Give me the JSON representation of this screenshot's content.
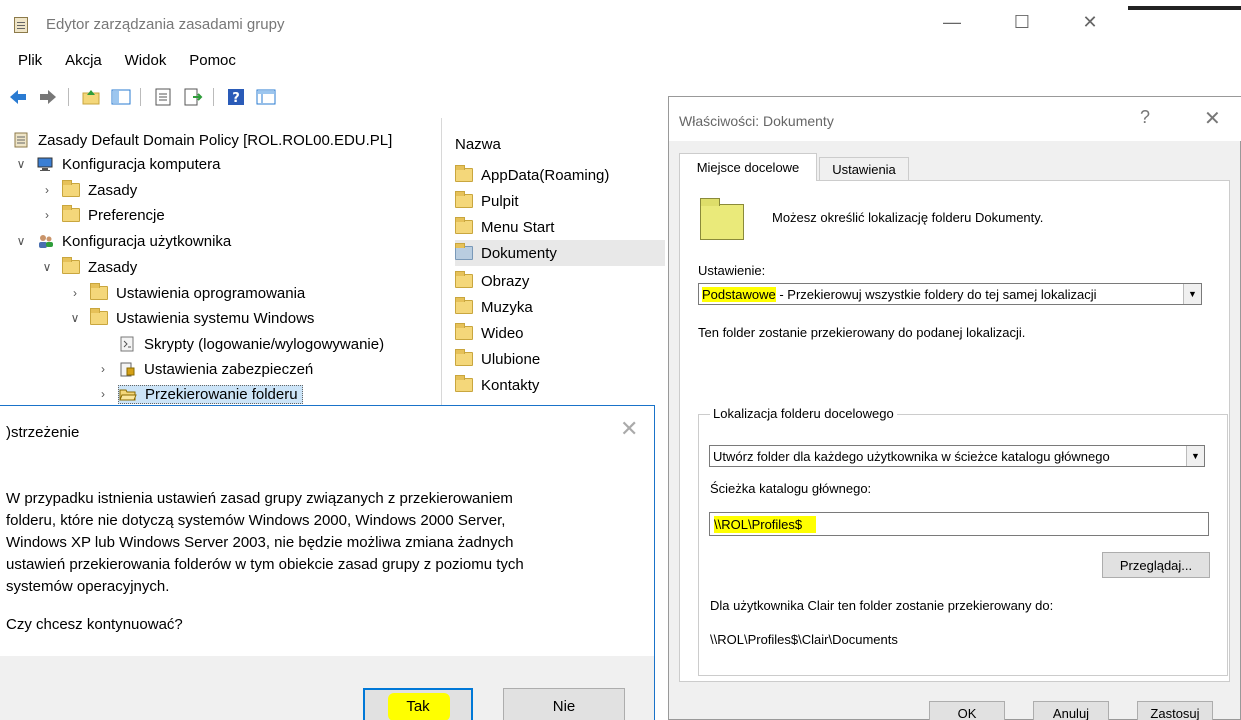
{
  "main": {
    "title": "Edytor zarządzania zasadami grupy",
    "window_controls": {
      "minimize": "—",
      "maximize": "☐",
      "close": "✕"
    },
    "menu": [
      "Plik",
      "Akcja",
      "Widok",
      "Pomoc"
    ]
  },
  "tree": {
    "root": "Zasady Default Domain Policy [ROL.ROL00.EDU.PL]",
    "computer_config": "Konfiguracja komputera",
    "computer_policies": "Zasady",
    "computer_preferences": "Preferencje",
    "user_config": "Konfiguracja użytkownika",
    "user_policies": "Zasady",
    "software_settings": "Ustawienia oprogramowania",
    "windows_settings": "Ustawienia systemu Windows",
    "scripts": "Skrypty (logowanie/wylogowywanie)",
    "security": "Ustawienia zabezpieczeń",
    "folder_redirection": "Przekierowanie folderu"
  },
  "list": {
    "header": "Nazwa",
    "items": [
      "AppData(Roaming)",
      "Pulpit",
      "Menu Start",
      "Dokumenty",
      "Obrazy",
      "Muzyka",
      "Wideo",
      "Ulubione",
      "Kontakty"
    ]
  },
  "warning": {
    "title": ")strzeżenie",
    "close": "✕",
    "message": "W przypadku istnienia ustawień zasad grupy związanych z przekierowaniem\nfolderu, które nie dotyczą systemów Windows 2000, Windows 2000 Server,\nWindows XP lub Windows Server 2003, nie będzie możliwa zmiana żadnych\nustawień przekierowania folderów w tym obiekcie zasad grupy z poziomu tych\nsystemów operacyjnych.",
    "question": "Czy chcesz kontynuować?",
    "yes": "Tak",
    "no": "Nie"
  },
  "props": {
    "title": "Właściwości: Dokumenty",
    "help": "?",
    "close": "✕",
    "tab_target": "Miejsce docelowe",
    "tab_settings": "Ustawienia",
    "description": "Możesz określić lokalizację folderu Dokumenty.",
    "setting_label": "Ustawienie:",
    "setting_value_highlight": "Podstawowe",
    "setting_value_rest": " - Przekierowuj wszystkie foldery do tej samej lokalizacji",
    "setting_note": "Ten folder zostanie przekierowany do podanej lokalizacji.",
    "group_label": "Lokalizacja folderu docelowego",
    "location_value": "Utwórz folder dla każdego użytkownika w ścieżce katalogu głównego",
    "root_label": "Ścieżka katalogu głównego:",
    "root_value": "\\\\ROL\\Profiles$",
    "browse": "Przeglądaj...",
    "redirect_note": "Dla użytkownika Clair ten folder zostanie przekierowany do:",
    "redirect_path": "\\\\ROL\\Profiles$\\Clair\\Documents",
    "ok": "OK",
    "cancel": "Anuluj",
    "apply": "Zastosuj"
  },
  "colors": {
    "highlight": "#ffff00",
    "accent": "#0078d7",
    "selection": "#cce4f7"
  }
}
